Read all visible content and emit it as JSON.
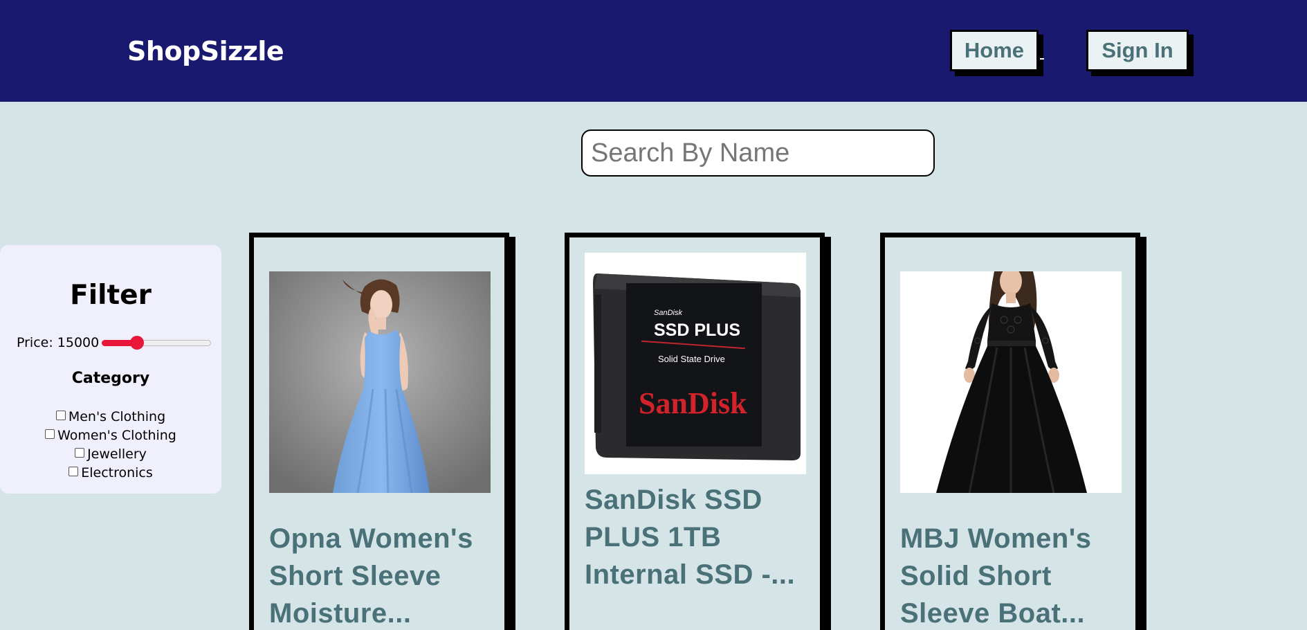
{
  "header": {
    "brand": "ShopSizzle",
    "nav": {
      "home": "Home",
      "sign_in": "Sign In"
    }
  },
  "search": {
    "placeholder": "Search By Name",
    "value": ""
  },
  "filter": {
    "title": "Filter",
    "price_label": "Price: 15000",
    "price_value": 15000,
    "price_slider_fraction": 0.32,
    "category_title": "Category",
    "categories": [
      {
        "label": "Men's Clothing",
        "checked": false
      },
      {
        "label": "Women's Clothing",
        "checked": false
      },
      {
        "label": "Jewellery",
        "checked": false
      },
      {
        "label": "Electronics",
        "checked": false
      }
    ]
  },
  "products": [
    {
      "title": "Opna Women's Short Sleeve Moisture...",
      "image": "blue-dress-photo"
    },
    {
      "title": "SanDisk SSD PLUS 1TB Internal SSD -...",
      "image": "sandisk-ssd-photo",
      "image_text": {
        "brand_small": "SanDisk",
        "model": "SSD PLUS",
        "subtitle": "Solid State Drive",
        "logo": "SanDisk"
      }
    },
    {
      "title": "MBJ Women's Solid Short Sleeve Boat...",
      "image": "black-dress-photo"
    }
  ],
  "colors": {
    "header_bg": "#191970",
    "page_bg": "#d5e4e6",
    "accent_text": "#4a7178",
    "slider_accent": "#e8173a"
  }
}
